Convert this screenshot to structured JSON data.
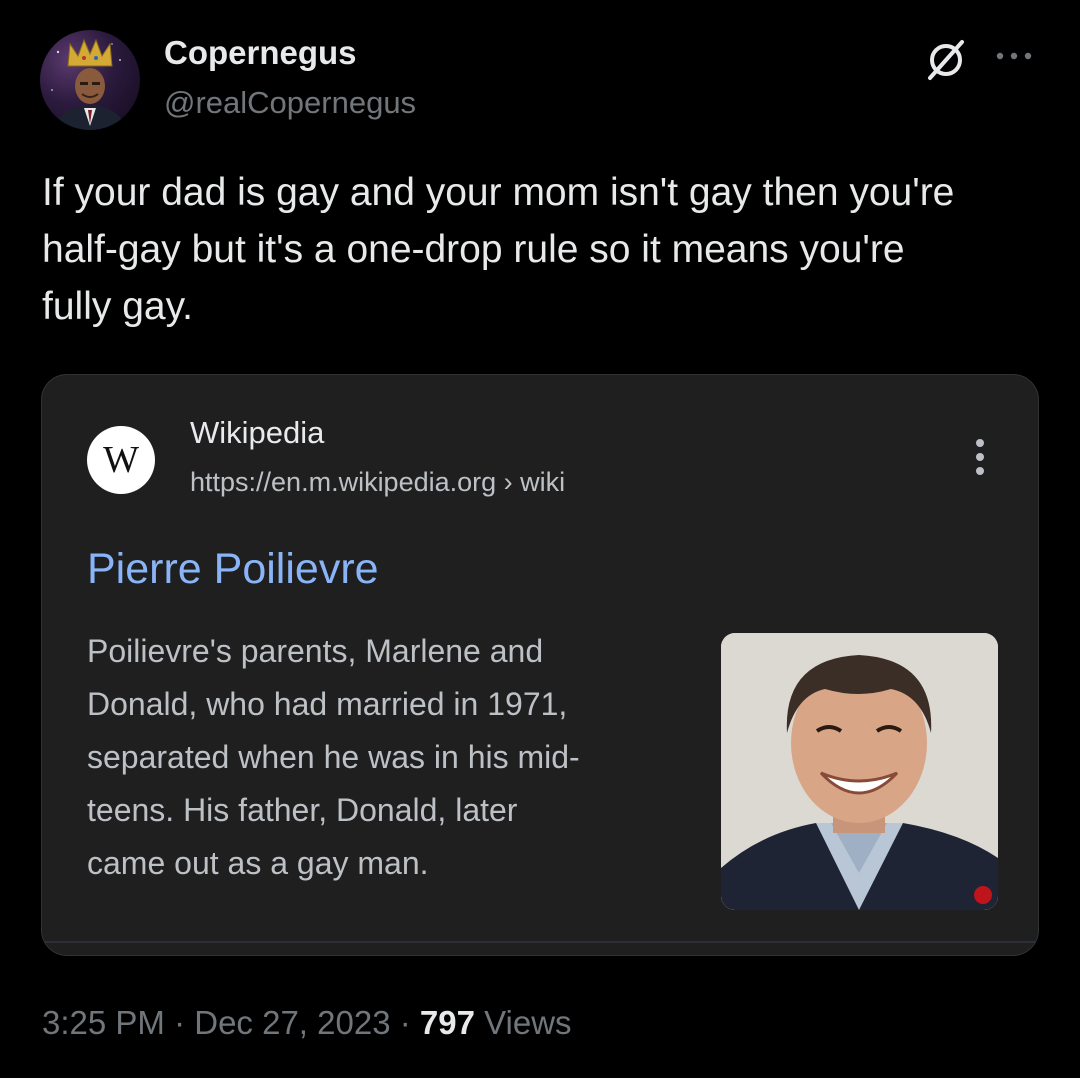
{
  "author": {
    "display_name": "Copernegus",
    "handle": "@realCopernegus"
  },
  "header_icons": [
    "grok-icon",
    "more-options-icon"
  ],
  "tweet": {
    "text": "If your dad is gay and your mom isn't gay then you're\nhalf-gay but it's a one-drop rule so it means you're\nfully gay."
  },
  "card": {
    "logo_letter": "W",
    "site_name": "Wikipedia",
    "site_url": "https://en.m.wikipedia.org › wiki",
    "title": "Pierre Poilievre",
    "snippet": "Poilievre's parents, Marlene and\nDonald, who had married in 1971,\nseparated when he was in his mid-\nteens. His father, Donald, later\ncame out as a gay man.",
    "menu_icon": "kebab-menu-icon"
  },
  "meta": {
    "time": "3:25 PM",
    "separator": " · ",
    "date": "Dec 27, 2023",
    "views_count": "797",
    "views_label": " Views"
  },
  "colors": {
    "background": "#000000",
    "card_background": "#1f1f1f",
    "link_blue": "#8ab4f8",
    "secondary_text": "#71767b",
    "primary_text": "#e7e9ea"
  }
}
